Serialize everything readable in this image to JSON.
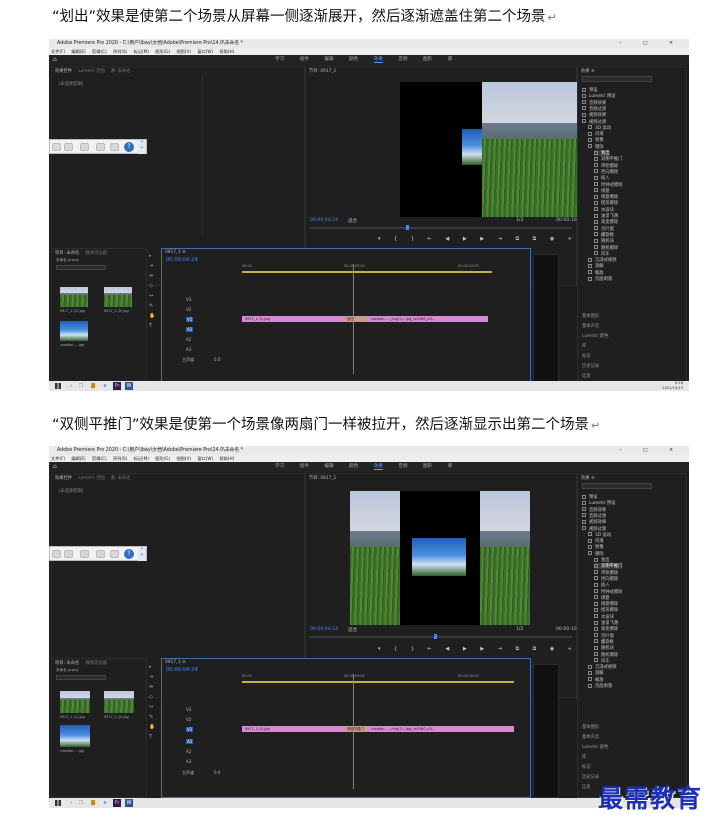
{
  "captions": [
    {
      "text": "“划出”效果是使第二个场景从屏幕一侧逐渐展开，然后逐渐遮盖住第二个场景",
      "mark": "↵"
    },
    {
      "text": "“双侧平推门”效果是使第一个场景像两扇门一样被拉开，然后逐渐显示出第二个场景",
      "mark": "↵"
    }
  ],
  "app": {
    "title": "Adobe Premiere Pro 2020 - C:\\用户\\lbay\\文档\\Adobe\\Premiere Pro\\14.0\\未命名 *",
    "window_controls": "– □ ×",
    "menu": [
      "文件(F)",
      "编辑(E)",
      "剪辑(C)",
      "序列(S)",
      "标记(M)",
      "图形(G)",
      "视图(V)",
      "窗口(W)",
      "帮助(H)"
    ],
    "workspaces": [
      "学习",
      "组件",
      "编辑",
      "颜色",
      "效果",
      "音频",
      "图形",
      "库"
    ],
    "active_workspace": "效果",
    "source_tabs": [
      "效果控件",
      "Lumetri 范围",
      "源: 未命名",
      "音频剪辑混合器"
    ],
    "source_empty": "（未选择剪辑）",
    "program_tab": "节目: 0917_1",
    "program_timecode": "00:00:04:24",
    "program_fit": "适合",
    "program_quality": "1/2",
    "program_duration": "00:00:10:00",
    "playback_controls": "▾ { } ⇤ ◀ ▶ ▶ ⇥ ⧉ ⧉ ◉ +",
    "project_tabs": [
      "项目: 未命名",
      "媒体浏览器"
    ],
    "project_file": "未命名.prproj",
    "project_items": [
      {
        "name": "0917_1 (1).jpg",
        "dur": "5:00"
      },
      {
        "name": "0917_1 (2).jpg",
        "dur": "5:00"
      },
      {
        "name": "crowfan.....jpg",
        "dur": "5:00"
      }
    ],
    "timeline_tab": "0917_1 ≡",
    "timeline_timecode": "00:00:04:24",
    "ruler_marks": [
      "00:00",
      "00:00:05:00",
      "00:00:10:00"
    ],
    "tracks": [
      "V3",
      "V2",
      "V1",
      "A1",
      "A2",
      "A3",
      "主声道"
    ],
    "master_val": "0.0",
    "clip1": "0917_1 (1).jpg",
    "transition": "划出",
    "transition2": "双侧平推门",
    "clip2": "crowfan....._img(1)...jpg_ce2580_s1l...",
    "effects_tab": "效果 ≡",
    "effects_tree": [
      "预设",
      "Lumetri 预设",
      "音频效果",
      "音频过渡",
      "视频效果",
      "视频过渡",
      "3D 运动",
      "内滑",
      "划像",
      "擦除",
      "划出",
      "双侧平推门",
      "带状擦除",
      "径向擦除",
      "插入",
      "时钟式擦除",
      "棋盘",
      "棋盘擦除",
      "楔形擦除",
      "水波块",
      "油漆飞溅",
      "渐变擦除",
      "百叶窗",
      "螺旋框",
      "随机块",
      "随机擦除",
      "风车",
      "沉浸式视频",
      "溶解",
      "缩放",
      "页面剥落"
    ],
    "right_bottom": [
      "基本图形",
      "基本声音",
      "Lumetri 颜色",
      "库",
      "标记",
      "历史记录",
      "信息"
    ],
    "clock_time": "9:16",
    "clock_date": "2021/10/15"
  },
  "watermark": "最需教育"
}
